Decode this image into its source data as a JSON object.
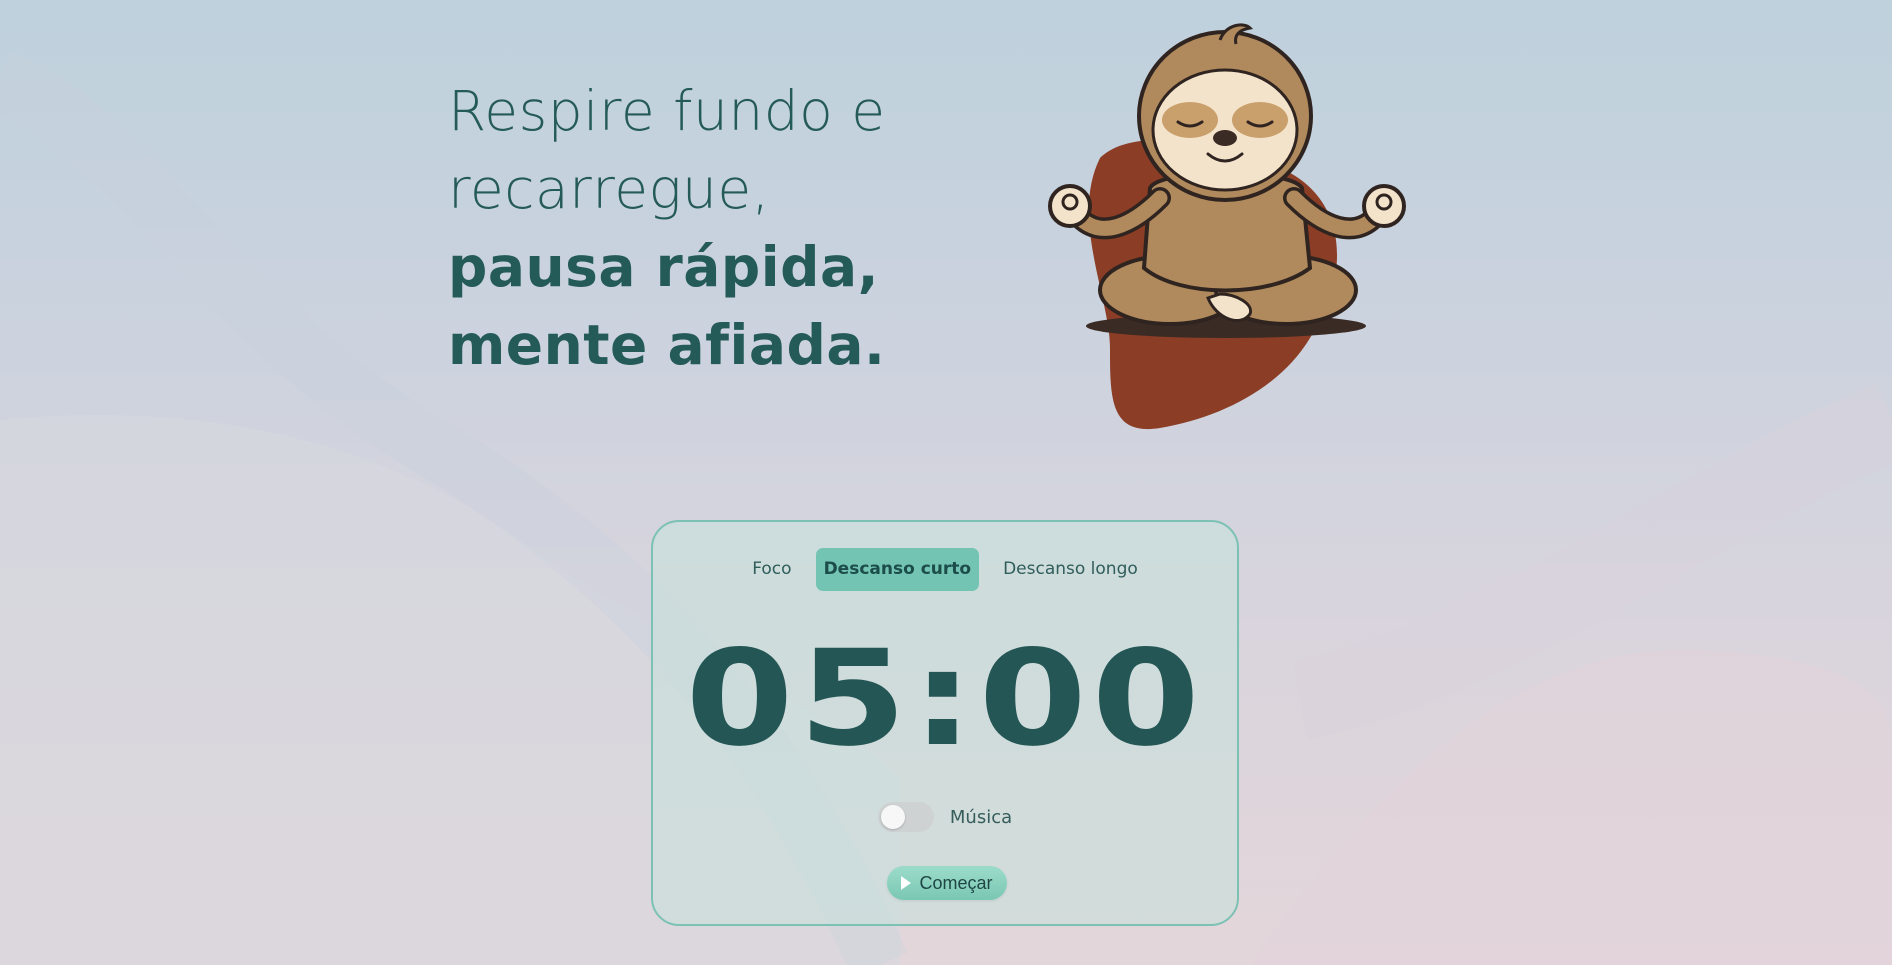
{
  "hero": {
    "line1": "Respire fundo e",
    "line2": "recarregue,",
    "line3": "pausa rápida,",
    "line4": "mente afiada."
  },
  "timer": {
    "tabs": [
      {
        "label": "Foco",
        "active": false
      },
      {
        "label": "Descanso curto",
        "active": true
      },
      {
        "label": "Descanso longo",
        "active": false
      }
    ],
    "time": "05:00",
    "music_label": "Música",
    "music_enabled": false,
    "start_label": "Começar"
  },
  "colors": {
    "accent": "#74c4b3",
    "text_dark": "#235655",
    "card_border": "#7cc2b4",
    "blob": "#8b3d25",
    "sloth_fur": "#b08a5c"
  },
  "icons": {
    "play": "play-icon",
    "mascot": "meditating-sloth"
  }
}
